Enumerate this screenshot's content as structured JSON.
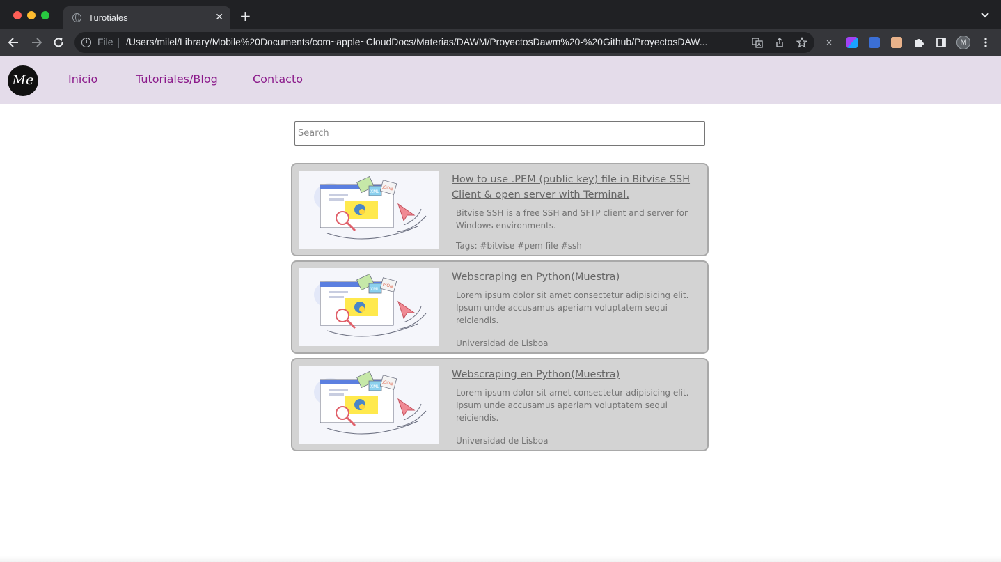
{
  "browser": {
    "tab_title": "Turotiales",
    "tab_close": "✕",
    "new_tab": "+",
    "scheme_label": "File",
    "url": "/Users/milel/Library/Mobile%20Documents/com~apple~CloudDocs/Materias/DAWM/ProyectosDawm%20-%20Github/ProyectosDAW...",
    "profile_initial": "M",
    "icons": [
      "back-icon",
      "forward-icon",
      "reload-icon",
      "info-icon",
      "translate-icon",
      "share-icon",
      "star-icon",
      "extensions-icon",
      "side-panel-icon",
      "menu-icon"
    ]
  },
  "site": {
    "logo_text": "Me",
    "nav": {
      "inicio": "Inicio",
      "blog": "Tutoriales/Blog",
      "contacto": "Contacto"
    },
    "search": {
      "placeholder": "Search",
      "value": ""
    },
    "cards": [
      {
        "title": "How to use .PEM (public key) file in Bitvise SSH Client & open server with Terminal.",
        "description": "Bitvise SSH is a free SSH and SFTP client and server for Windows environments.",
        "footer": "Tags: #bitvise #pem file #ssh"
      },
      {
        "title": "Webscraping en Python(Muestra)",
        "description": "Lorem ipsum dolor sit amet consectetur adipisicing elit. Ipsum unde accusamus aperiam voluptatem sequi reiciendis.",
        "footer": "Universidad de Lisboa"
      },
      {
        "title": "Webscraping en Python(Muestra)",
        "description": "Lorem ipsum dolor sit amet consectetur adipisicing elit. Ipsum unde accusamus aperiam voluptatem sequi reiciendis.",
        "footer": "Universidad de Lisboa"
      }
    ],
    "thumbnail_labels": {
      "xml": "XML",
      "json": "JSON"
    }
  },
  "colors": {
    "nav_bg": "#e4dcea",
    "nav_link": "#8b1a8b",
    "card_bg": "#d3d3d3",
    "card_border": "#a9a9a9"
  }
}
